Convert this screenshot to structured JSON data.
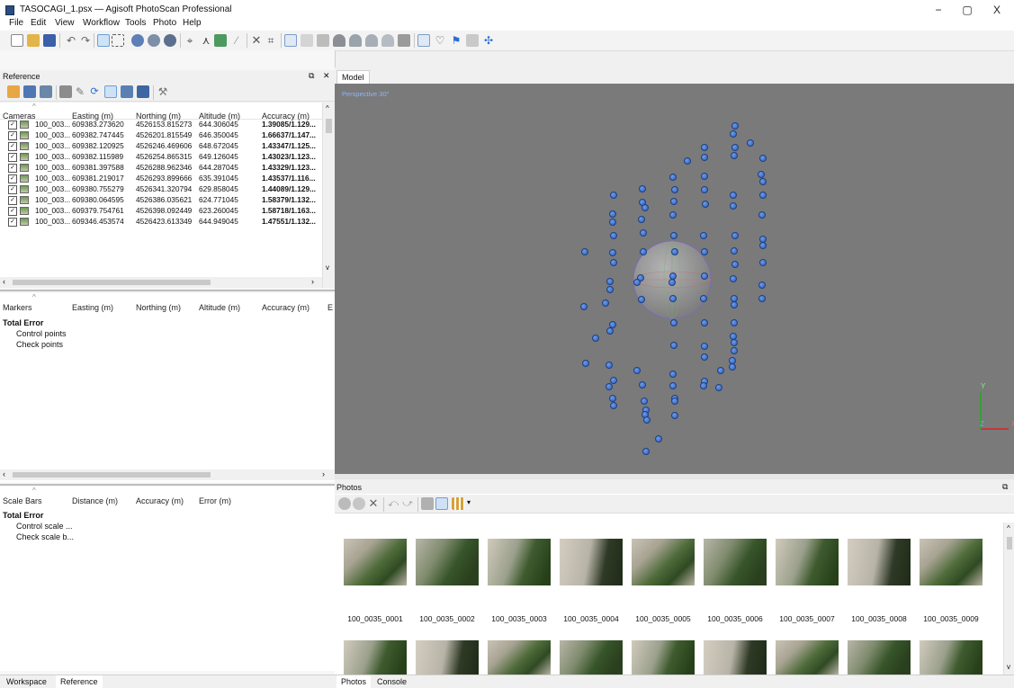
{
  "window": {
    "title": "TASOCAGI_1.psx — Agisoft PhotoScan Professional",
    "controls": {
      "minimize": "−",
      "maximize": "▢",
      "close": "X"
    }
  },
  "menu": [
    "File",
    "Edit",
    "View",
    "Workflow",
    "Tools",
    "Photo",
    "Help"
  ],
  "reference": {
    "title": "Reference",
    "cameras": {
      "headers": [
        "Cameras",
        "Easting (m)",
        "Northing (m)",
        "Altitude (m)",
        "Accuracy (m)"
      ],
      "rows": [
        {
          "name": "100_003...",
          "easting": "609383.273620",
          "northing": "4526153.815273",
          "altitude": "644.306045",
          "accuracy": "1.39085/1.129..."
        },
        {
          "name": "100_003...",
          "easting": "609382.747445",
          "northing": "4526201.815549",
          "altitude": "646.350045",
          "accuracy": "1.66637/1.147..."
        },
        {
          "name": "100_003...",
          "easting": "609382.120925",
          "northing": "4526246.469606",
          "altitude": "648.672045",
          "accuracy": "1.43347/1.125..."
        },
        {
          "name": "100_003...",
          "easting": "609382.115989",
          "northing": "4526254.865315",
          "altitude": "649.126045",
          "accuracy": "1.43023/1.123..."
        },
        {
          "name": "100_003...",
          "easting": "609381.397588",
          "northing": "4526288.962346",
          "altitude": "644.287045",
          "accuracy": "1.43329/1.123..."
        },
        {
          "name": "100_003...",
          "easting": "609381.219017",
          "northing": "4526293.899666",
          "altitude": "635.391045",
          "accuracy": "1.43537/1.116..."
        },
        {
          "name": "100_003...",
          "easting": "609380.755279",
          "northing": "4526341.320794",
          "altitude": "629.858045",
          "accuracy": "1.44089/1.129..."
        },
        {
          "name": "100_003...",
          "easting": "609380.064595",
          "northing": "4526386.035621",
          "altitude": "624.771045",
          "accuracy": "1.58379/1.132..."
        },
        {
          "name": "100_003...",
          "easting": "609379.754761",
          "northing": "4526398.092449",
          "altitude": "623.260045",
          "accuracy": "1.58718/1.163..."
        },
        {
          "name": "100_003...",
          "easting": "609346.453574",
          "northing": "4526423.613349",
          "altitude": "644.949045",
          "accuracy": "1.47551/1.132..."
        }
      ]
    },
    "markers": {
      "headers": [
        "Markers",
        "Easting (m)",
        "Northing (m)",
        "Altitude (m)",
        "Accuracy (m)",
        "E"
      ],
      "total": "Total Error",
      "items": [
        "Control points",
        "Check points"
      ]
    },
    "scalebars": {
      "headers": [
        "Scale Bars",
        "Distance (m)",
        "Accuracy (m)",
        "Error (m)"
      ],
      "total": "Total Error",
      "items": [
        "Control scale ...",
        "Check scale b..."
      ]
    }
  },
  "model": {
    "tab": "Model",
    "perspective": "Perspective 30°",
    "axes": {
      "y": "Y",
      "z": "Z",
      "x": "X"
    }
  },
  "photos": {
    "title": "Photos",
    "labels": [
      "100_0035_0001",
      "100_0035_0002",
      "100_0035_0003",
      "100_0035_0004",
      "100_0035_0005",
      "100_0035_0006",
      "100_0035_0007",
      "100_0035_0008",
      "100_0035_0009"
    ]
  },
  "bottom_tabs": {
    "left": [
      "Workspace",
      "Reference"
    ],
    "right": [
      "Photos",
      "Console"
    ]
  }
}
